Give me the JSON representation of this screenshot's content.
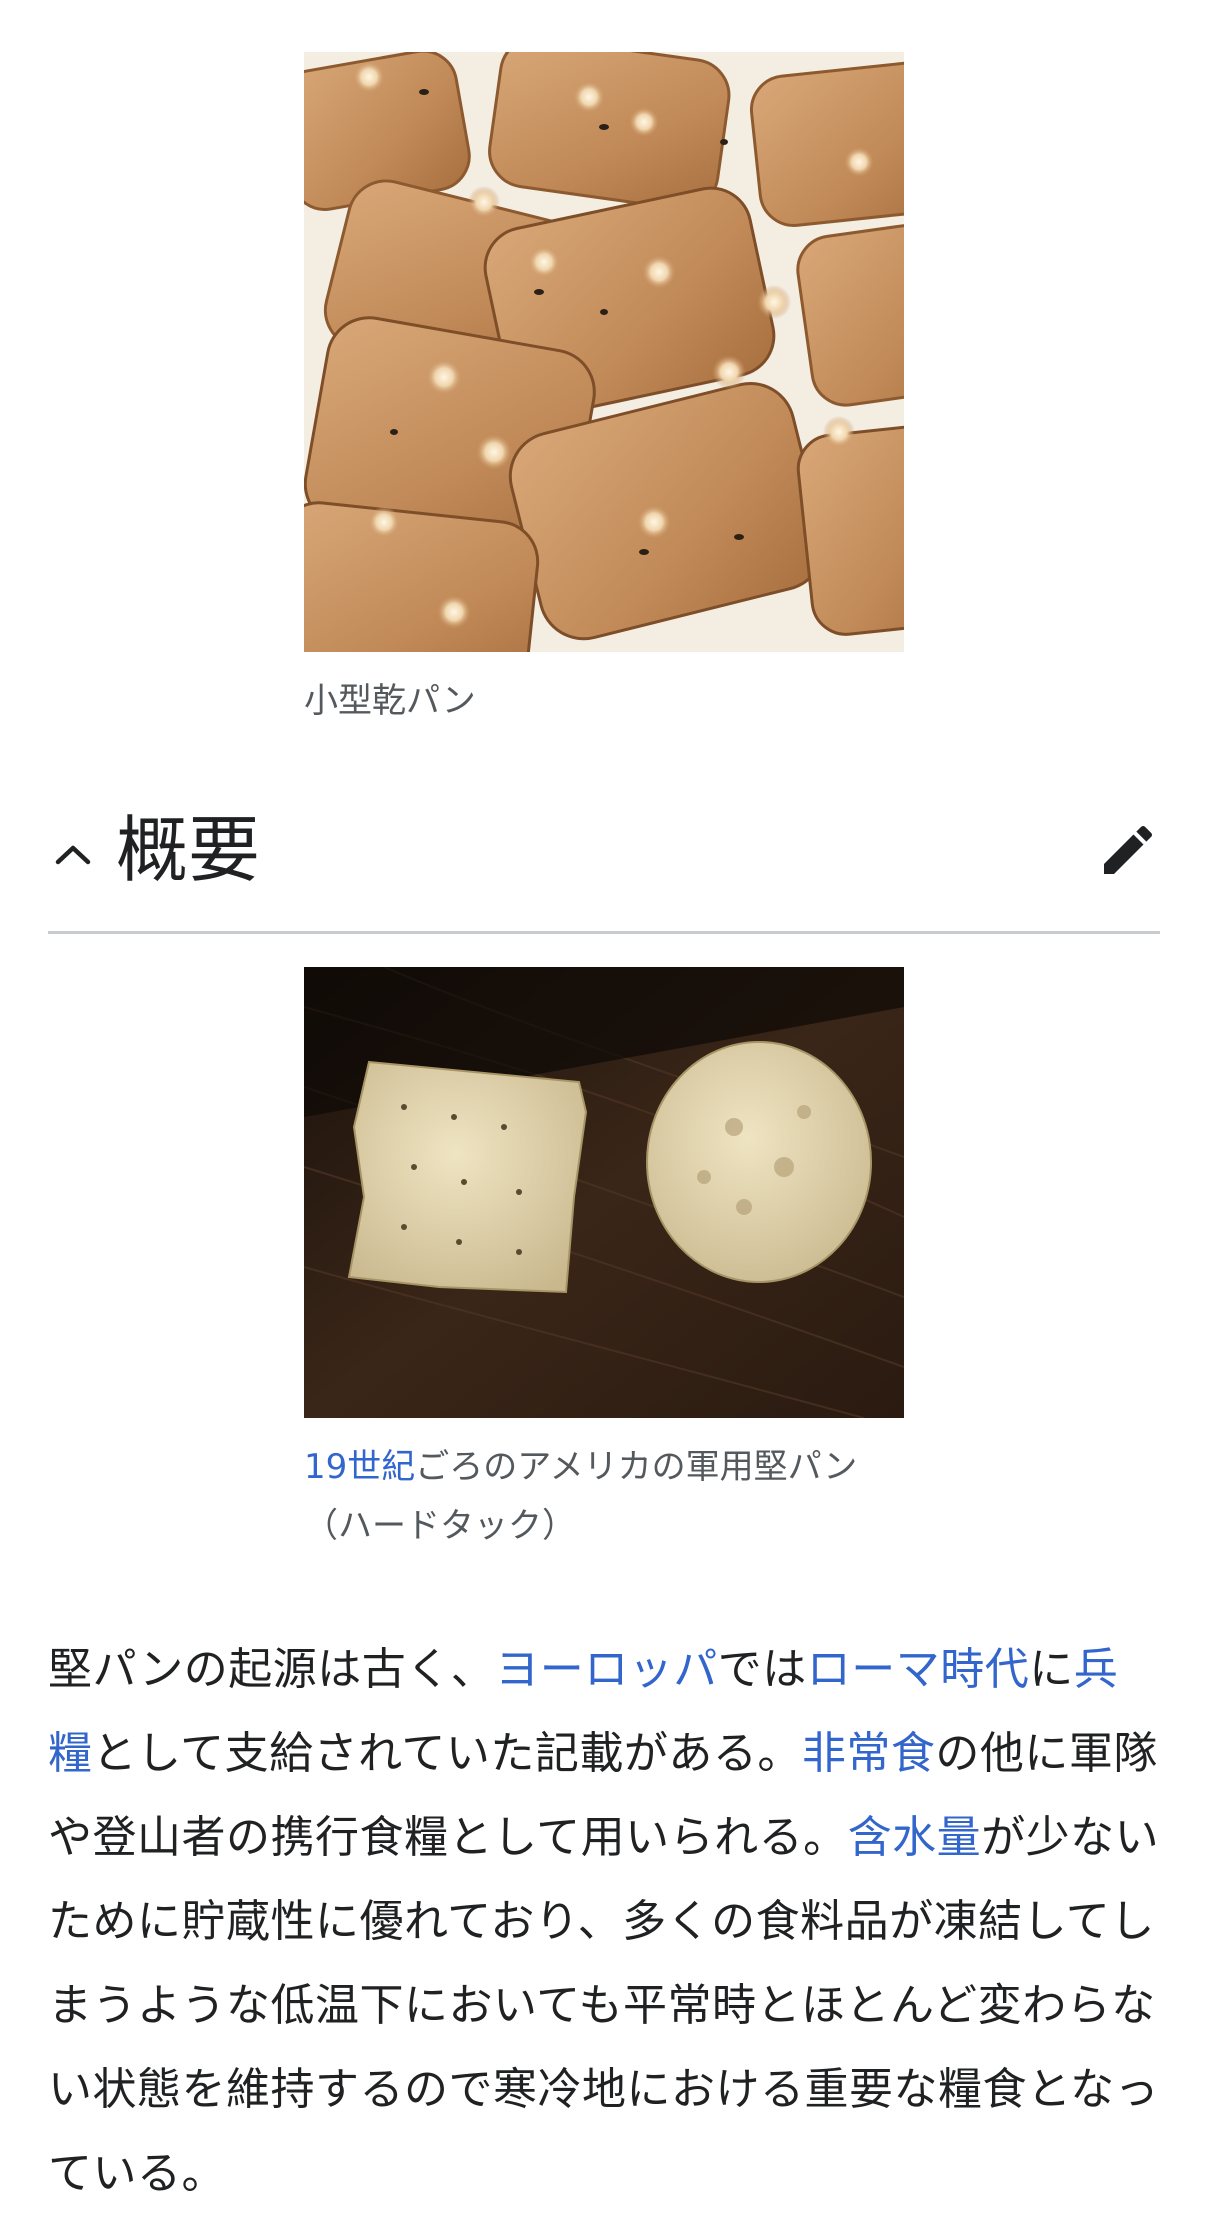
{
  "figures": [
    {
      "alt": "小型乾パン",
      "caption": "小型乾パン"
    },
    {
      "caption_link": "19世紀",
      "caption_rest": "ごろのアメリカの軍用堅パン（ハードタック）"
    }
  ],
  "section": {
    "title": "概要",
    "collapse_icon": "chevron-up-icon",
    "edit_icon": "pencil-icon"
  },
  "paragraph": {
    "t1": "堅パンの起源は古く、",
    "l1": "ヨーロッパ",
    "t2": "では",
    "l2": "ローマ時代",
    "t3": "に",
    "l3": "兵糧",
    "t4": "として支給されていた記載がある。",
    "l4": "非常食",
    "t5": "の他に軍隊や登山者の携行食糧として用いられる。",
    "l5": "含水量",
    "t6": "が少ないために貯蔵性に優れており、多くの食料品が凍結してしまうような低温下においても平常時とほとんど変わらない状態を維持するので寒冷地における重要な糧食となっている。"
  },
  "colors": {
    "link": "#3366cc",
    "text": "#202122",
    "caption": "#54595d",
    "divider": "#c8ccd1"
  }
}
